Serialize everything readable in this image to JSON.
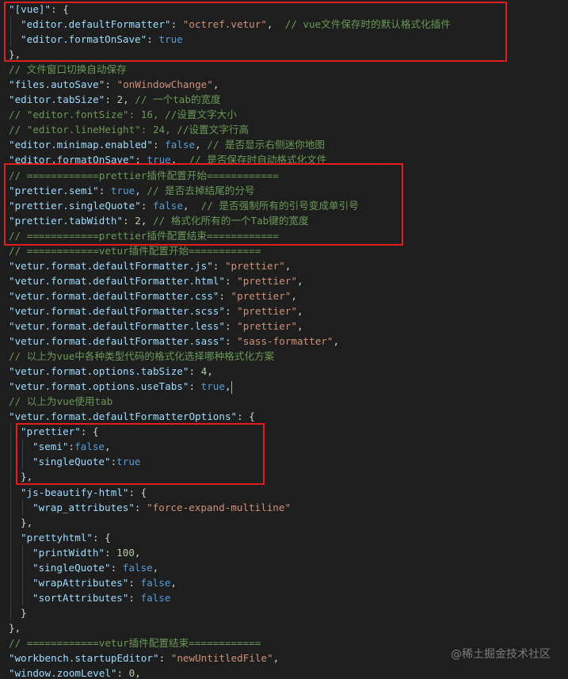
{
  "colors": {
    "background": "#1e1e1e",
    "key": "#9cdcfe",
    "string": "#ce9178",
    "number": "#b5cea8",
    "boolean": "#569cd6",
    "comment": "#6a9955",
    "punctuation": "#d4d4d4",
    "highlight_box": "#e51c1c",
    "indent_guide": "#404040"
  },
  "watermark": "@稀土掘金技术社区",
  "lines": [
    {
      "indent": 0,
      "tokens": [
        [
          "k",
          "\"[vue]\""
        ],
        [
          "p",
          ": {"
        ]
      ]
    },
    {
      "indent": 1,
      "tokens": [
        [
          "k",
          "\"editor.defaultFormatter\""
        ],
        [
          "p",
          ": "
        ],
        [
          "s",
          "\"octref.vetur\""
        ],
        [
          "p",
          ",  "
        ],
        [
          "c",
          "// vue文件保存时的默认格式化插件"
        ]
      ]
    },
    {
      "indent": 1,
      "tokens": [
        [
          "k",
          "\"editor.formatOnSave\""
        ],
        [
          "p",
          ": "
        ],
        [
          "b",
          "true"
        ]
      ]
    },
    {
      "indent": 0,
      "tokens": [
        [
          "p",
          "},"
        ]
      ]
    },
    {
      "indent": 0,
      "tokens": [
        [
          "c",
          "// 文件窗口切换自动保存"
        ]
      ]
    },
    {
      "indent": 0,
      "tokens": [
        [
          "k",
          "\"files.autoSave\""
        ],
        [
          "p",
          ": "
        ],
        [
          "s",
          "\"onWindowChange\""
        ],
        [
          "p",
          ","
        ]
      ]
    },
    {
      "indent": 0,
      "tokens": [
        [
          "k",
          "\"editor.tabSize\""
        ],
        [
          "p",
          ": "
        ],
        [
          "n",
          "2"
        ],
        [
          "p",
          ", "
        ],
        [
          "c",
          "// 一个tab的宽度"
        ]
      ]
    },
    {
      "indent": 0,
      "tokens": [
        [
          "c",
          "// \"editor.fontSize\": 16, //设置文字大小"
        ]
      ]
    },
    {
      "indent": 0,
      "tokens": [
        [
          "c",
          "// \"editor.lineHeight\": 24, //设置文字行高"
        ]
      ]
    },
    {
      "indent": 0,
      "tokens": [
        [
          "k",
          "\"editor.minimap.enabled\""
        ],
        [
          "p",
          ": "
        ],
        [
          "b",
          "false"
        ],
        [
          "p",
          ", "
        ],
        [
          "c",
          "// 是否显示右侧迷你地图"
        ]
      ]
    },
    {
      "indent": 0,
      "tokens": [
        [
          "k",
          "\"editor.formatOnSave\""
        ],
        [
          "p",
          ": "
        ],
        [
          "b",
          "true"
        ],
        [
          "p",
          ",  "
        ],
        [
          "c",
          "// 是否保存时自动格式化文件"
        ]
      ]
    },
    {
      "indent": 0,
      "tokens": [
        [
          "c",
          "// ============prettier插件配置开始============"
        ]
      ]
    },
    {
      "indent": 0,
      "tokens": [
        [
          "k",
          "\"prettier.semi\""
        ],
        [
          "p",
          ": "
        ],
        [
          "b",
          "true"
        ],
        [
          "p",
          ", "
        ],
        [
          "c",
          "// 是否去掉结尾的分号"
        ]
      ]
    },
    {
      "indent": 0,
      "tokens": [
        [
          "k",
          "\"prettier.singleQuote\""
        ],
        [
          "p",
          ": "
        ],
        [
          "b",
          "false"
        ],
        [
          "p",
          ",  "
        ],
        [
          "c",
          "// 是否强制所有的引号变成单引号"
        ]
      ]
    },
    {
      "indent": 0,
      "tokens": [
        [
          "k",
          "\"prettier.tabWidth\""
        ],
        [
          "p",
          ": "
        ],
        [
          "n",
          "2"
        ],
        [
          "p",
          ", "
        ],
        [
          "c",
          "// 格式化所有的一个Tab键的宽度"
        ]
      ]
    },
    {
      "indent": 0,
      "tokens": [
        [
          "c",
          "// ============prettier插件配置结束============"
        ]
      ]
    },
    {
      "indent": 0,
      "tokens": [
        [
          "c",
          "// ============vetur插件配置开始============"
        ]
      ]
    },
    {
      "indent": 0,
      "tokens": [
        [
          "k",
          "\"vetur.format.defaultFormatter.js\""
        ],
        [
          "p",
          ": "
        ],
        [
          "s",
          "\"prettier\""
        ],
        [
          "p",
          ","
        ]
      ]
    },
    {
      "indent": 0,
      "tokens": [
        [
          "k",
          "\"vetur.format.defaultFormatter.html\""
        ],
        [
          "p",
          ": "
        ],
        [
          "s",
          "\"prettier\""
        ],
        [
          "p",
          ","
        ]
      ]
    },
    {
      "indent": 0,
      "tokens": [
        [
          "k",
          "\"vetur.format.defaultFormatter.css\""
        ],
        [
          "p",
          ": "
        ],
        [
          "s",
          "\"prettier\""
        ],
        [
          "p",
          ","
        ]
      ]
    },
    {
      "indent": 0,
      "tokens": [
        [
          "k",
          "\"vetur.format.defaultFormatter.scss\""
        ],
        [
          "p",
          ": "
        ],
        [
          "s",
          "\"prettier\""
        ],
        [
          "p",
          ","
        ]
      ]
    },
    {
      "indent": 0,
      "tokens": [
        [
          "k",
          "\"vetur.format.defaultFormatter.less\""
        ],
        [
          "p",
          ": "
        ],
        [
          "s",
          "\"prettier\""
        ],
        [
          "p",
          ","
        ]
      ]
    },
    {
      "indent": 0,
      "tokens": [
        [
          "k",
          "\"vetur.format.defaultFormatter.sass\""
        ],
        [
          "p",
          ": "
        ],
        [
          "s",
          "\"sass-formatter\""
        ],
        [
          "p",
          ","
        ]
      ]
    },
    {
      "indent": 0,
      "tokens": [
        [
          "c",
          "// 以上为vue中各种类型代码的格式化选择哪种格式化方案"
        ]
      ]
    },
    {
      "indent": 0,
      "tokens": [
        [
          "k",
          "\"vetur.format.options.tabSize\""
        ],
        [
          "p",
          ": "
        ],
        [
          "n",
          "4"
        ],
        [
          "p",
          ","
        ]
      ]
    },
    {
      "indent": 0,
      "cursor": true,
      "tokens": [
        [
          "k",
          "\"vetur.format.options.useTabs\""
        ],
        [
          "p",
          ": "
        ],
        [
          "b",
          "true"
        ],
        [
          "p",
          ","
        ]
      ]
    },
    {
      "indent": 0,
      "tokens": [
        [
          "c",
          "// 以上为vue使用tab"
        ]
      ]
    },
    {
      "indent": 0,
      "tokens": [
        [
          "k",
          "\"vetur.format.defaultFormatterOptions\""
        ],
        [
          "p",
          ": {"
        ]
      ]
    },
    {
      "indent": 1,
      "tokens": [
        [
          "k",
          "\"prettier\""
        ],
        [
          "p",
          ": {"
        ]
      ]
    },
    {
      "indent": 2,
      "tokens": [
        [
          "k",
          "\"semi\""
        ],
        [
          "p",
          ":"
        ],
        [
          "b",
          "false"
        ],
        [
          "p",
          ","
        ]
      ]
    },
    {
      "indent": 2,
      "tokens": [
        [
          "k",
          "\"singleQuote\""
        ],
        [
          "p",
          ":"
        ],
        [
          "b",
          "true"
        ]
      ]
    },
    {
      "indent": 1,
      "tokens": [
        [
          "p",
          "},"
        ]
      ]
    },
    {
      "indent": 1,
      "tokens": [
        [
          "k",
          "\"js-beautify-html\""
        ],
        [
          "p",
          ": {"
        ]
      ]
    },
    {
      "indent": 2,
      "tokens": [
        [
          "k",
          "\"wrap_attributes\""
        ],
        [
          "p",
          ": "
        ],
        [
          "s",
          "\"force-expand-multiline\""
        ]
      ]
    },
    {
      "indent": 1,
      "tokens": [
        [
          "p",
          "},"
        ]
      ]
    },
    {
      "indent": 1,
      "tokens": [
        [
          "k",
          "\"prettyhtml\""
        ],
        [
          "p",
          ": {"
        ]
      ]
    },
    {
      "indent": 2,
      "tokens": [
        [
          "k",
          "\"printWidth\""
        ],
        [
          "p",
          ": "
        ],
        [
          "n",
          "100"
        ],
        [
          "p",
          ","
        ]
      ]
    },
    {
      "indent": 2,
      "tokens": [
        [
          "k",
          "\"singleQuote\""
        ],
        [
          "p",
          ": "
        ],
        [
          "b",
          "false"
        ],
        [
          "p",
          ","
        ]
      ]
    },
    {
      "indent": 2,
      "tokens": [
        [
          "k",
          "\"wrapAttributes\""
        ],
        [
          "p",
          ": "
        ],
        [
          "b",
          "false"
        ],
        [
          "p",
          ","
        ]
      ]
    },
    {
      "indent": 2,
      "tokens": [
        [
          "k",
          "\"sortAttributes\""
        ],
        [
          "p",
          ": "
        ],
        [
          "b",
          "false"
        ]
      ]
    },
    {
      "indent": 1,
      "tokens": [
        [
          "p",
          "}"
        ]
      ]
    },
    {
      "indent": 0,
      "tokens": [
        [
          "p",
          "},"
        ]
      ]
    },
    {
      "indent": 0,
      "tokens": [
        [
          "c",
          "// ============vetur插件配置结束============"
        ]
      ]
    },
    {
      "indent": 0,
      "tokens": [
        [
          "k",
          "\"workbench.startupEditor\""
        ],
        [
          "p",
          ": "
        ],
        [
          "s",
          "\"newUntitledFile\""
        ],
        [
          "p",
          ","
        ]
      ]
    },
    {
      "indent": 0,
      "tokens": [
        [
          "k",
          "\"window.zoomLevel\""
        ],
        [
          "p",
          ": "
        ],
        [
          "n",
          "0"
        ],
        [
          "p",
          ","
        ]
      ]
    }
  ]
}
